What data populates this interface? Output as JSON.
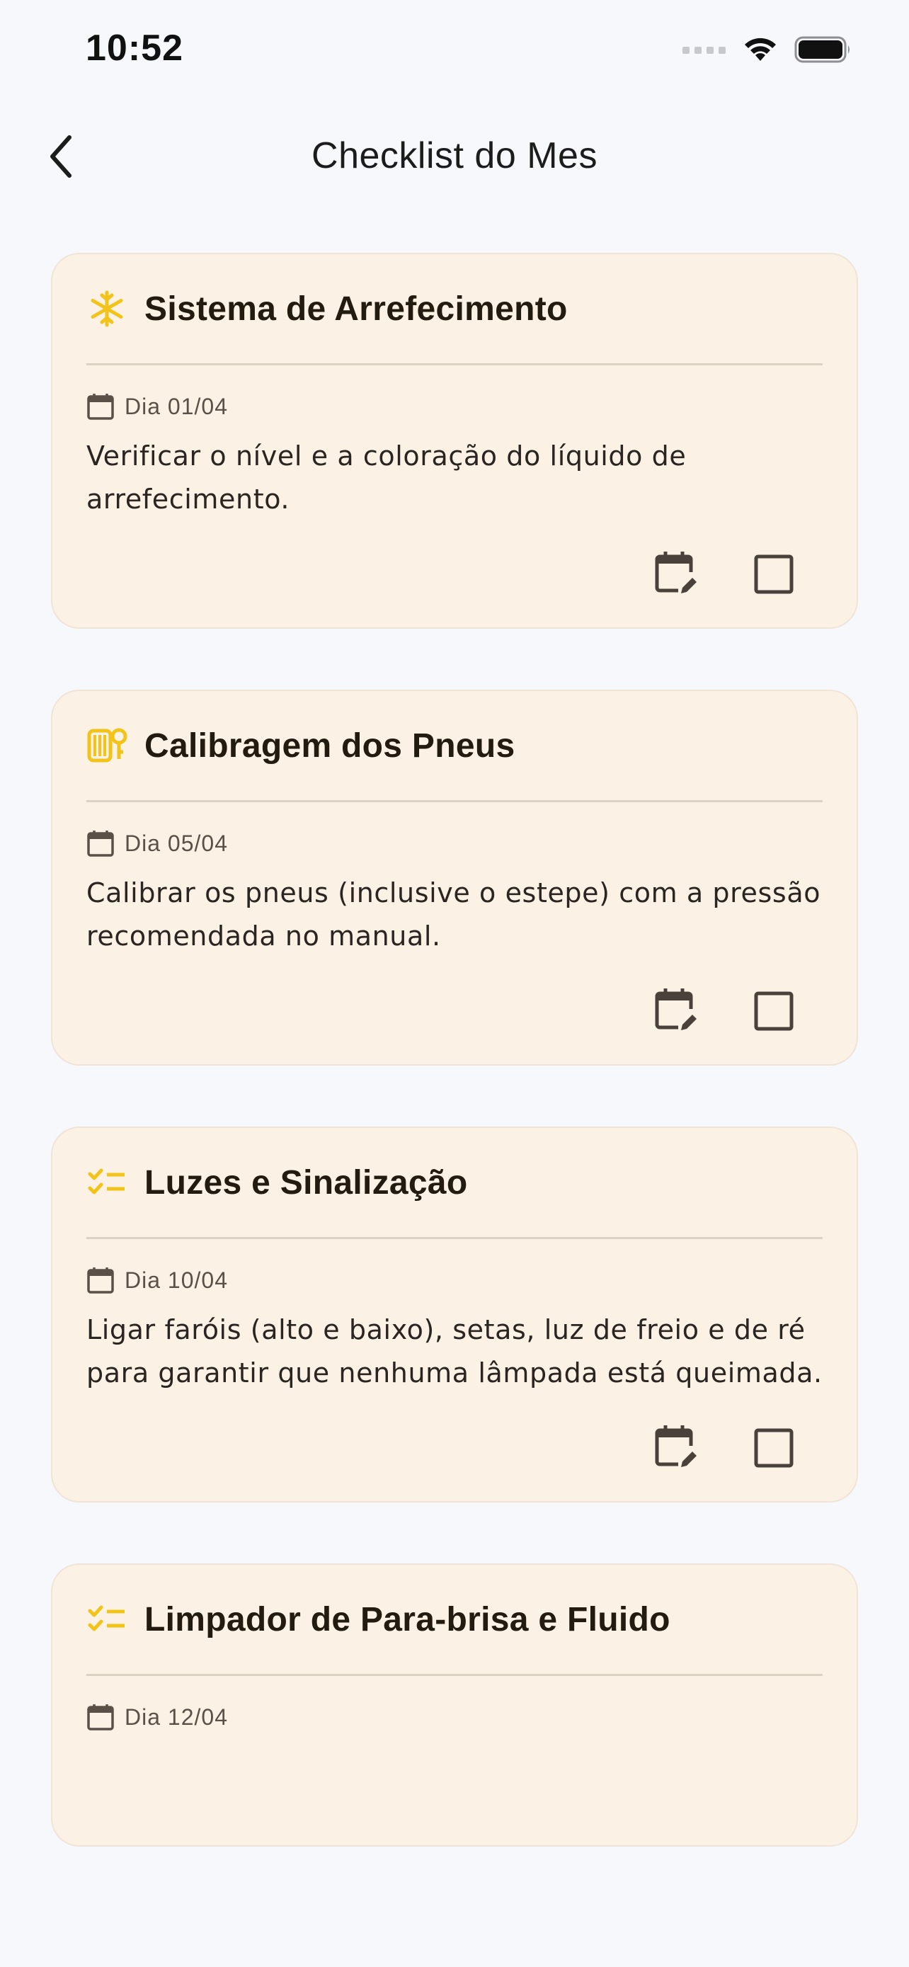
{
  "status_bar": {
    "time": "10:52",
    "icons": [
      "signal-dots-icon",
      "wifi-icon",
      "battery-icon"
    ]
  },
  "header": {
    "title": "Checklist do Mes",
    "back_icon": "chevron-left-icon"
  },
  "colors": {
    "background": "#F7F8FB",
    "card_background": "#FBF1E5",
    "accent_yellow": "#F2C318",
    "icon_dark": "#4A423A"
  },
  "cards": [
    {
      "icon": "snowflake-icon",
      "title": "Sistema de Arrefecimento",
      "date": "Dia 01/04",
      "description": "Verificar o nível e a coloração do líquido de arrefecimento."
    },
    {
      "icon": "tire-pressure-icon",
      "title": "Calibragem dos Pneus",
      "date": "Dia 05/04",
      "description": "Calibrar os pneus (inclusive o estepe) com a pressão recomendada no manual."
    },
    {
      "icon": "checklist-icon",
      "title": "Luzes e Sinalização",
      "date": "Dia 10/04",
      "description": "Ligar faróis (alto e baixo), setas, luz de freio e de ré para garantir que nenhuma lâmpada está queimada."
    },
    {
      "icon": "checklist-icon",
      "title": "Limpador de Para-brisa e Fluido",
      "date": "Dia 12/04",
      "description": ""
    }
  ]
}
